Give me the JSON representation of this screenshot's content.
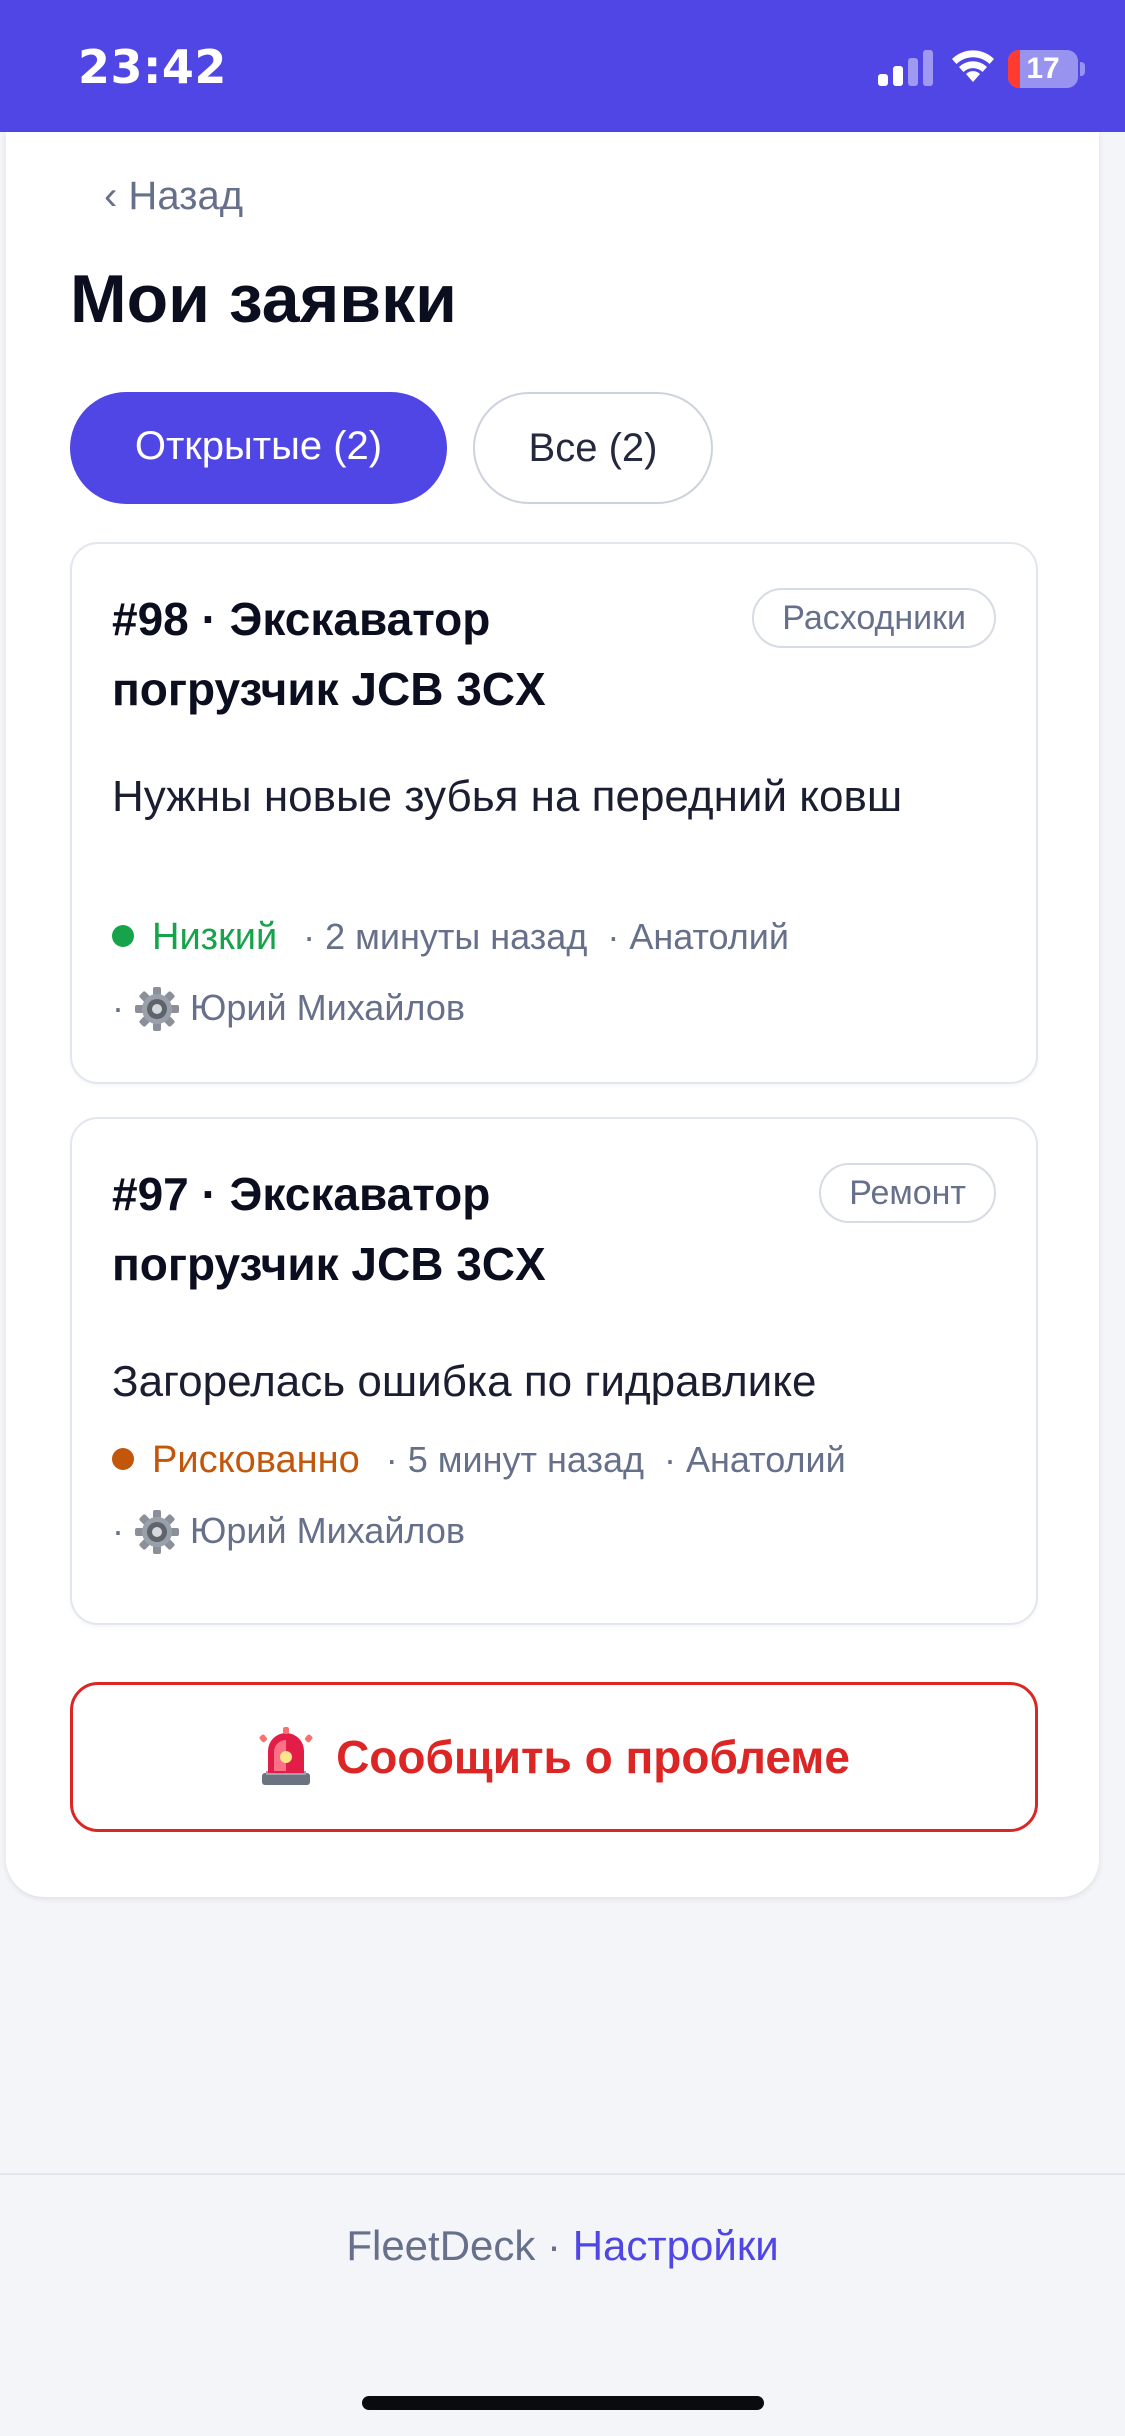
{
  "status_bar": {
    "time": "23:42",
    "battery_level": "17",
    "battery_fraction": 0.17,
    "accent_color": "#5046e5"
  },
  "header": {
    "back_label": "‹ Назад",
    "title": "Мои заявки"
  },
  "tabs": [
    {
      "label": "Открытые (2)",
      "active": true
    },
    {
      "label": "Все (2)",
      "active": false
    }
  ],
  "tickets": [
    {
      "title": "#98 · Экскаватор погрузчик JCB 3CX",
      "category": "Расходники",
      "description": "Нужны новые зубья на передний ковш",
      "priority": "Низкий",
      "priority_color": "#16a34a",
      "time_ago": "· 2 минуты назад",
      "author": "· Анатолий",
      "assignee_prefix": "·",
      "assignee": "Юрий Михайлов"
    },
    {
      "title": "#97 · Экскаватор погрузчик JCB 3CX",
      "category": "Ремонт",
      "description": "Загорелась ошибка по гидравлике",
      "priority": "Рискованно",
      "priority_color": "#c2570c",
      "time_ago": "· 5 минут назад",
      "author": "· Анатолий",
      "assignee_prefix": "·",
      "assignee": "Юрий Михайлов"
    }
  ],
  "report_button": {
    "icon": "siren-icon",
    "label": "Сообщить о проблеме",
    "color": "#dc2626"
  },
  "footer": {
    "app_name": "FleetDeck",
    "separator": " · ",
    "settings_link": "Настройки"
  }
}
